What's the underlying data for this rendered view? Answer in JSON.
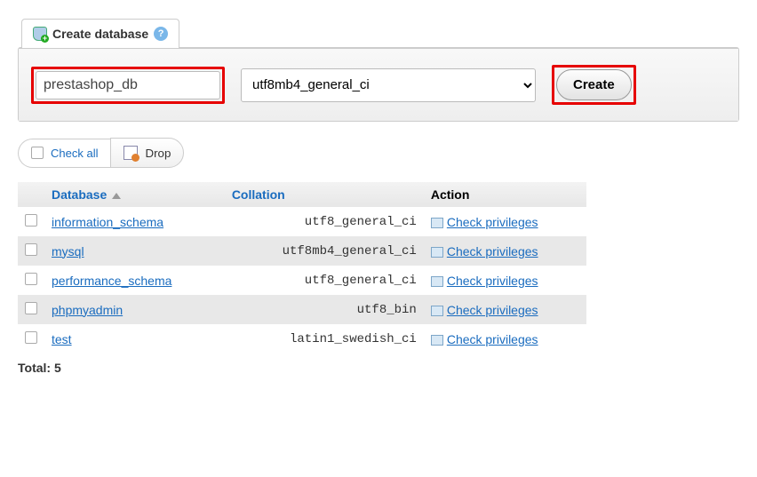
{
  "create": {
    "tab_label": "Create database",
    "db_name_value": "prestashop_db",
    "collation_selected": "utf8mb4_general_ci",
    "create_button": "Create"
  },
  "toolbar": {
    "check_all": "Check all",
    "drop": "Drop"
  },
  "table": {
    "headers": {
      "database": "Database",
      "collation": "Collation",
      "action": "Action"
    },
    "priv_label": "Check privileges",
    "rows": [
      {
        "name": "information_schema",
        "collation": "utf8_general_ci"
      },
      {
        "name": "mysql",
        "collation": "utf8mb4_general_ci"
      },
      {
        "name": "performance_schema",
        "collation": "utf8_general_ci"
      },
      {
        "name": "phpmyadmin",
        "collation": "utf8_bin"
      },
      {
        "name": "test",
        "collation": "latin1_swedish_ci"
      }
    ]
  },
  "total": {
    "label": "Total: ",
    "count": "5"
  }
}
